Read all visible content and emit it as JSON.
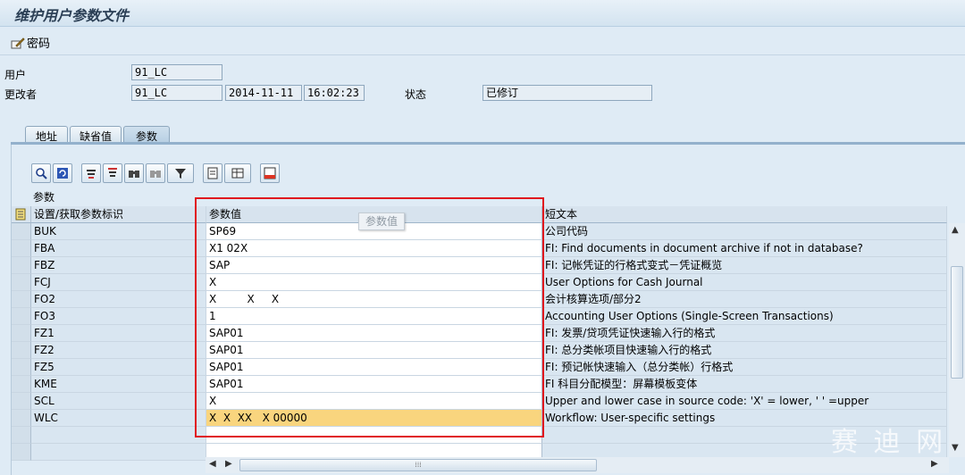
{
  "window": {
    "title": "维护用户参数文件"
  },
  "app_toolbar": {
    "password_label": "密码"
  },
  "header": {
    "user_label": "用户",
    "user_value": "91_LC",
    "changed_by_label": "更改者",
    "changed_by_value": "91_LC",
    "changed_date": "2014-11-11",
    "changed_time": "16:02:23",
    "status_label": "状态",
    "status_value": "已修订"
  },
  "tabs": [
    {
      "label": "地址",
      "active": false
    },
    {
      "label": "缺省值",
      "active": false
    },
    {
      "label": "参数",
      "active": true
    }
  ],
  "grid": {
    "title": "参数",
    "columns": [
      "设置/获取参数标识",
      "参数值",
      "短文本"
    ],
    "rows": [
      {
        "id": "BUK",
        "value": "SP69",
        "text": "公司代码"
      },
      {
        "id": "FBA",
        "value": "X1 02X",
        "text": "FI: Find documents in document archive if not in database?"
      },
      {
        "id": "FBZ",
        "value": "SAP",
        "text": "FI: 记帐凭证的行格式变式－凭证概览"
      },
      {
        "id": "FCJ",
        "value": "X",
        "text": "User Options for Cash Journal"
      },
      {
        "id": "FO2",
        "value": "X         X     X",
        "text": "会计核算选项/部分2"
      },
      {
        "id": "FO3",
        "value": "1",
        "text": "Accounting User Options (Single-Screen Transactions)"
      },
      {
        "id": "FZ1",
        "value": "SAP01",
        "text": "FI: 发票/贷项凭证快速输入行的格式"
      },
      {
        "id": "FZ2",
        "value": "SAP01",
        "text": "FI: 总分类帐项目快速输入行的格式"
      },
      {
        "id": "FZ5",
        "value": "SAP01",
        "text": "FI: 预记帐快速输入（总分类帐）行格式"
      },
      {
        "id": "KME",
        "value": "SAP01",
        "text": "FI 科目分配模型：屏幕模板变体"
      },
      {
        "id": "SCL",
        "value": "X",
        "text": "Upper and lower case in source code: 'X' = lower, ' ' =upper"
      },
      {
        "id": "WLC",
        "value": "X  X  XX   X 00000",
        "text": "Workflow: User-specific settings"
      },
      {
        "id": "",
        "value": "",
        "text": ""
      },
      {
        "id": "",
        "value": "",
        "text": ""
      }
    ],
    "highlighted_row": 11
  },
  "tooltip": {
    "text": "参数值"
  },
  "watermark": {
    "text": "赛 迪 网"
  },
  "colors": {
    "highlight_annotation": "#e0161e",
    "selected_cell": "#f9d57e"
  }
}
